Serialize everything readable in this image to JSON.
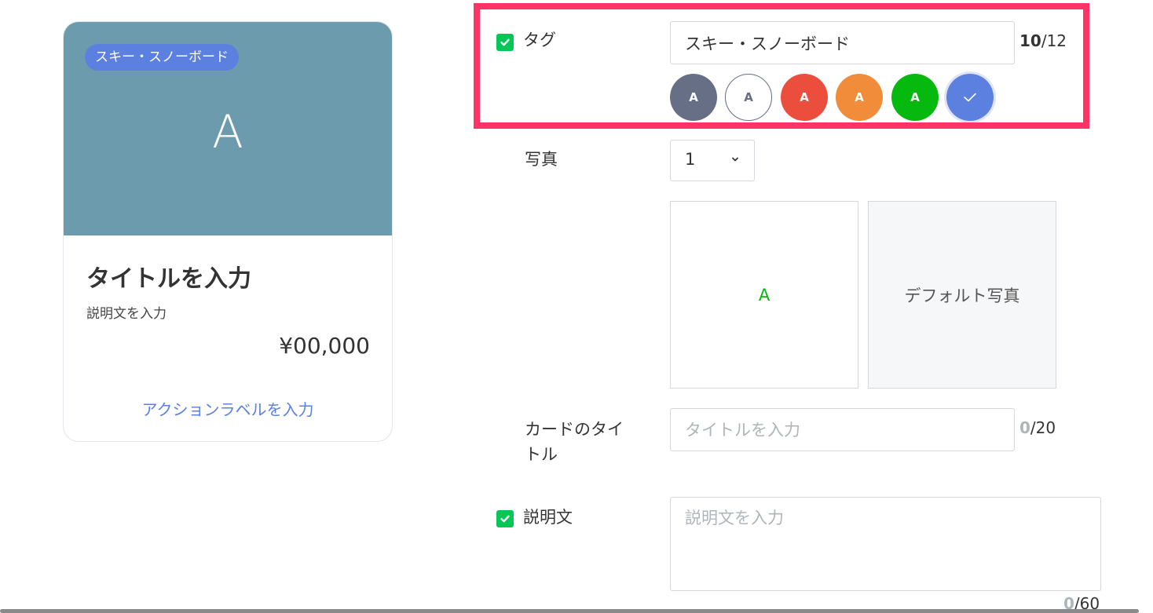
{
  "preview": {
    "tag": "スキー・スノーボード",
    "image_letter": "A",
    "title": "タイトルを入力",
    "description": "説明文を入力",
    "price": "¥00,000",
    "action_label": "アクションラベルを入力"
  },
  "form": {
    "tag": {
      "label": "タグ",
      "value": "スキー・スノーボード",
      "count_current": "10",
      "count_max": "/12",
      "swatch_letter": "A",
      "swatches": [
        {
          "name": "slate",
          "color": "#666f86"
        },
        {
          "name": "white",
          "color": "#ffffff"
        },
        {
          "name": "red",
          "color": "#eb4e3d"
        },
        {
          "name": "orange",
          "color": "#f08c3a"
        },
        {
          "name": "green",
          "color": "#06b90e"
        },
        {
          "name": "blue-selected",
          "color": "#5b80df"
        }
      ]
    },
    "photo": {
      "label": "写真",
      "count_selected": "1",
      "photo1_letter": "A",
      "photo2_label": "デフォルト写真"
    },
    "card_title": {
      "label_line1": "カードのタイ",
      "label_line2": "トル",
      "placeholder": "タイトルを入力",
      "count_current": "0",
      "count_max": "/20"
    },
    "description": {
      "label": "説明文",
      "placeholder": "説明文を入力",
      "count_current": "0",
      "count_max": "/60"
    }
  },
  "colors": {
    "accent_blue": "#5b80df",
    "check_green": "#06c755",
    "highlight": "#ff3366",
    "preview_image_bg": "#6b9bac"
  }
}
